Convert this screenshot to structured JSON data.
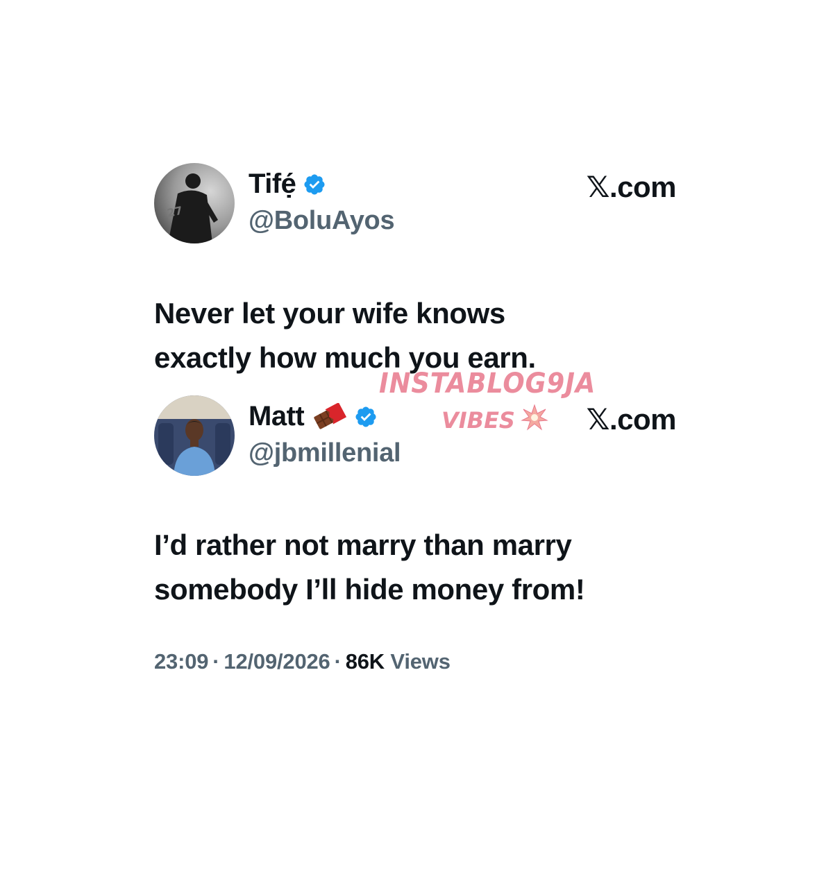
{
  "tweets": [
    {
      "display_name": "Tifẹ́",
      "handle": "@BoluAyos",
      "verified": true,
      "brand": "𝕏.com",
      "avatar_icon": "avatar-silhouette-player",
      "text": "Never let your wife  knows\nexactly how much you earn."
    },
    {
      "display_name": "Matt",
      "name_emoji": "chocolate-bar-icon",
      "handle": "@jbmillenial",
      "verified": true,
      "brand": "𝕏.com",
      "avatar_icon": "avatar-man-blue-shirt",
      "text": "I’d rather not marry than marry\nsomebody I’ll hide money from!"
    }
  ],
  "meta": {
    "time": "23:09",
    "separator": "·",
    "date": "12/09/2026",
    "views_count": "86K",
    "views_label": "Views"
  },
  "watermark": {
    "line1": "INSTABLOG9JA",
    "line2": "VIBES",
    "icon": "collision-icon"
  },
  "colors": {
    "text_primary": "#0f1419",
    "text_secondary": "#536471",
    "verified_blue": "#1d9bf0",
    "watermark_pink": "#e8788c"
  }
}
